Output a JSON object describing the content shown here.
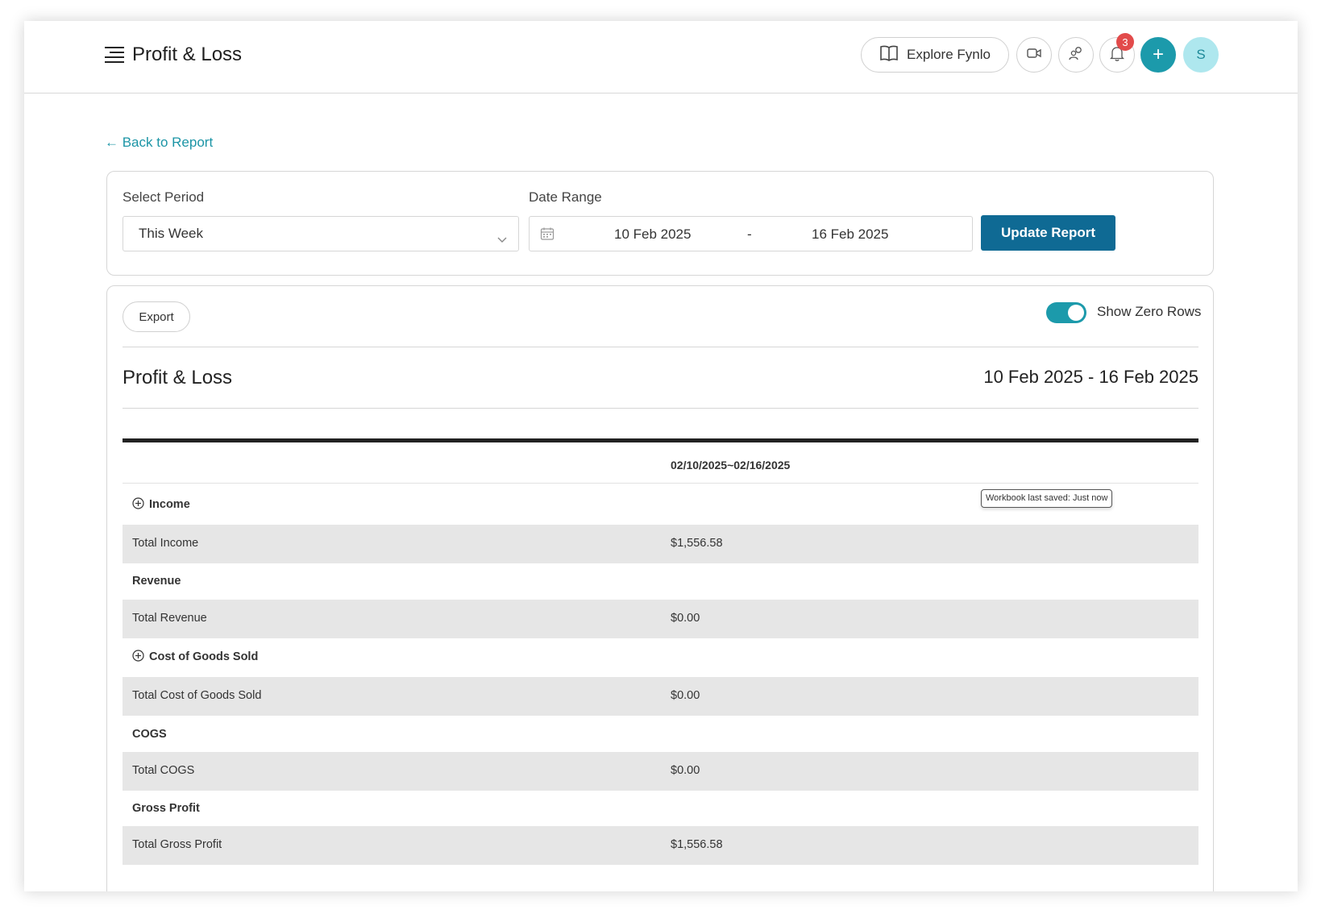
{
  "header": {
    "title": "Profit & Loss",
    "explore_label": "Explore Fynlo",
    "notification_count": "3",
    "avatar_initial": "S",
    "icons": [
      "menu-icon",
      "book-icon",
      "video-icon",
      "users-icon",
      "bell-icon",
      "plus-icon"
    ]
  },
  "back_link": "← Back to Report",
  "filters": {
    "period_label": "Select Period",
    "period_value": "This Week",
    "date_range_label": "Date Range",
    "date_start": "10 Feb 2025",
    "date_separator": "-",
    "date_end": "16 Feb 2025",
    "update_label": "Update Report"
  },
  "report": {
    "export_label": "Export",
    "show_zero_rows_label": "Show Zero Rows",
    "show_zero_rows_on": true,
    "title": "Profit & Loss",
    "range": "10 Feb 2025 - 16 Feb 2025",
    "column_header": "02/10/2025~02/16/2025",
    "tooltip": "Workbook last saved: Just now",
    "rows": [
      {
        "name": "Income",
        "value": "",
        "type": "section",
        "expandable": true
      },
      {
        "name": "Total Income",
        "value": "$1,556.58",
        "type": "total"
      },
      {
        "name": "Revenue",
        "value": "",
        "type": "section"
      },
      {
        "name": "Total Revenue",
        "value": "$0.00",
        "type": "total"
      },
      {
        "name": "Cost of Goods Sold",
        "value": "",
        "type": "section",
        "expandable": true
      },
      {
        "name": "Total Cost of Goods Sold",
        "value": "$0.00",
        "type": "total"
      },
      {
        "name": "COGS",
        "value": "",
        "type": "section"
      },
      {
        "name": "Total COGS",
        "value": "$0.00",
        "type": "total"
      },
      {
        "name": "Gross Profit",
        "value": "",
        "type": "section"
      },
      {
        "name": "Total Gross Profit",
        "value": "$1,556.58",
        "type": "total"
      }
    ]
  },
  "colors": {
    "accent": "#1c9aab",
    "primary_button": "#0f6a94",
    "badge": "#e24b4b",
    "avatar_bg": "#aee7ee",
    "total_row_bg": "#e6e6e6"
  }
}
